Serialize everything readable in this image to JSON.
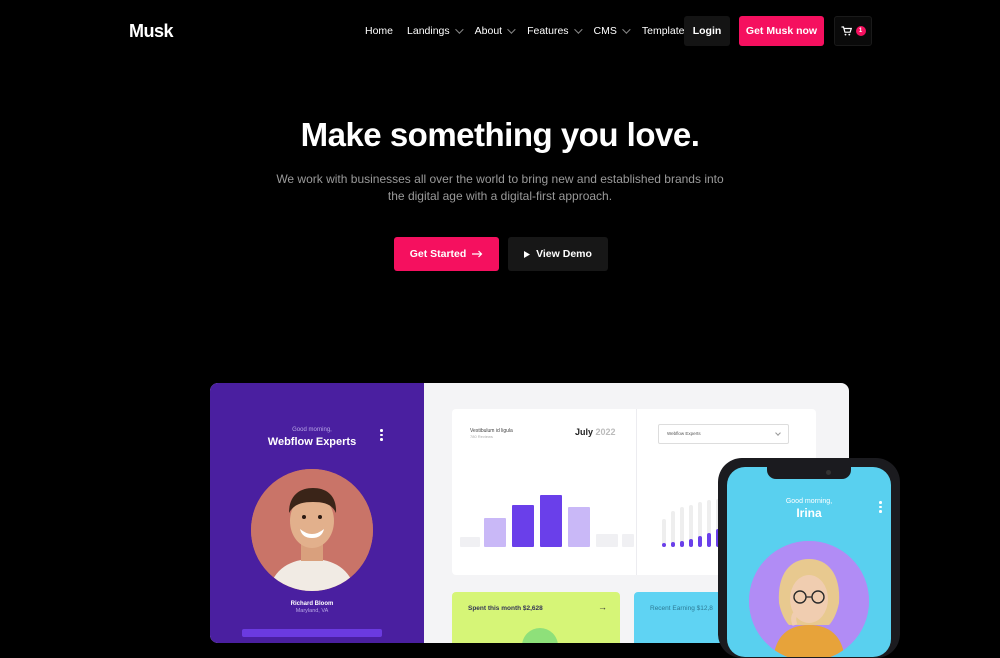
{
  "brand": {
    "logo": "Musk"
  },
  "nav": {
    "items": [
      {
        "label": "Home",
        "dropdown": false
      },
      {
        "label": "Landings",
        "dropdown": true
      },
      {
        "label": "About",
        "dropdown": true
      },
      {
        "label": "Features",
        "dropdown": true
      },
      {
        "label": "CMS",
        "dropdown": true
      },
      {
        "label": "Template",
        "dropdown": true
      }
    ],
    "login_label": "Login",
    "cta_label": "Get Musk now",
    "cart_count": "1"
  },
  "hero": {
    "title": "Make something you love.",
    "subtitle": "We work with businesses all over the world to bring new and established brands into the digital age with a digital-first approach.",
    "primary_label": "Get Started",
    "secondary_label": "View Demo"
  },
  "mockup": {
    "sidebar": {
      "greeting": "Good morning,",
      "name": "Webflow Experts",
      "person_name": "Richard Bloom",
      "person_location": "Maryland, VA"
    },
    "chart_card": {
      "label": "Vestibulum id ligula",
      "sublabel": "780 Reviews",
      "month": "July",
      "year": "2022",
      "select_value": "Webflow Experts"
    },
    "green_card": {
      "label": "Spent this month $2,628"
    },
    "blue_card": {
      "label": "Recent Earning $12,8"
    }
  },
  "phone": {
    "greeting": "Good morning,",
    "name": "Irina"
  },
  "colors": {
    "accent": "#f5105f",
    "purple": "#4a1fa0",
    "bar_active": "#6a3fea",
    "bar_light": "#c9b8f7",
    "green": "#d6f577",
    "blue": "#5fd3f3"
  }
}
